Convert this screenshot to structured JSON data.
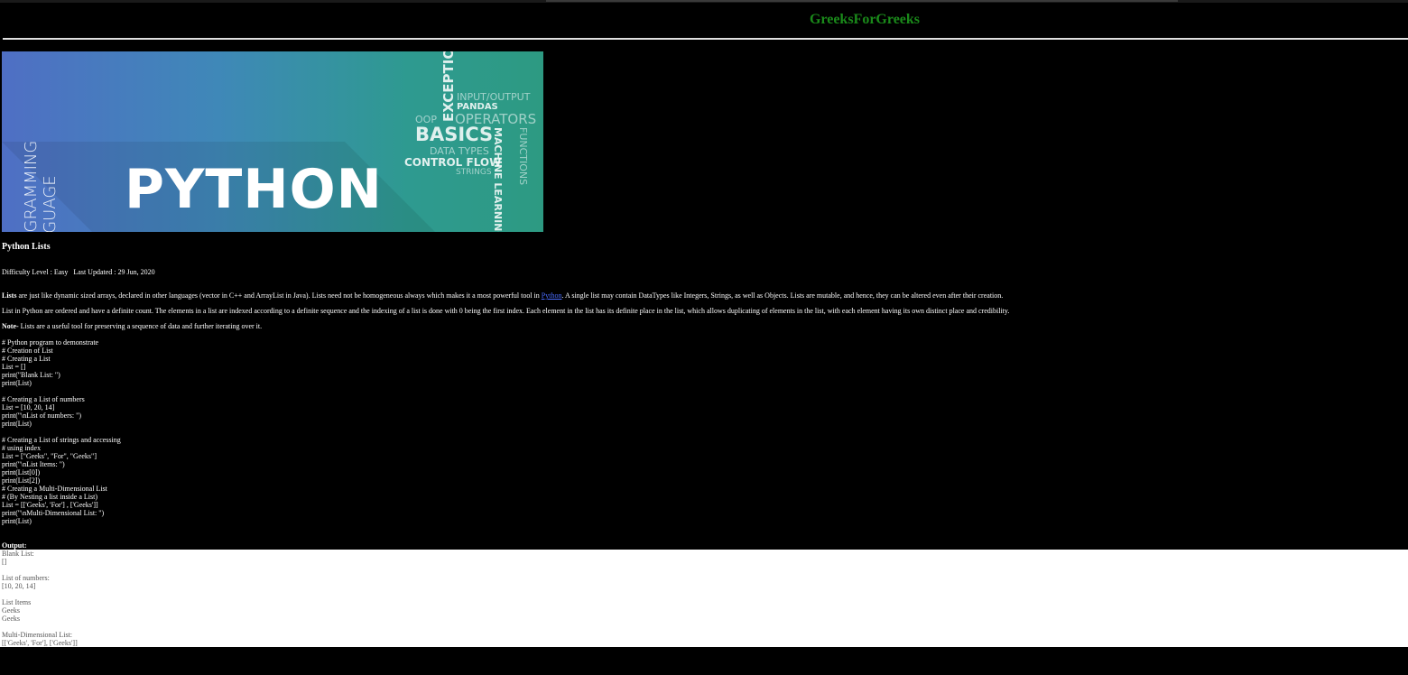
{
  "site": {
    "title": "GreeksForGreeks"
  },
  "banner": {
    "left_text_line1": "PROGRAMMING",
    "left_text_line2": "LANGUAGE",
    "main_text": "PYTHON",
    "tags": {
      "exception": "EXCEPTION",
      "input_output": "INPUT/OUTPUT",
      "pandas": "PANDAS",
      "oop": "OOP",
      "operators": "OPERATORS",
      "basics": "BASICS",
      "data_types": "DATA TYPES",
      "control_flow": "CONTROL FLOW",
      "strings": "STRINGS",
      "machine_learning": "MACHINE LEARNING",
      "functions": "FUNCTIONS"
    }
  },
  "article": {
    "title": "Python Lists",
    "difficulty": "Difficulty Level : Easy",
    "last_updated": "Last Updated : 29 Jun, 2020",
    "p1_bold": "Lists",
    "p1_text_a": " are just like dynamic sized arrays, declared in other languages (vector in C++ and ArrayList in Java). Lists need not be homogeneous always which makes it a most powerful tool in ",
    "p1_link": "Python",
    "p1_text_b": ". A single list may contain DataTypes like Integers, Strings, as well as Objects. Lists are mutable, and hence, they can be altered even after their creation.",
    "p2": "List in Python are ordered and have a definite count. The elements in a list are indexed according to a definite sequence and the indexing of a list is done with 0 being the first index. Each element in the list has its definite place in the list, which allows duplicating of elements in the list, with each element having its own distinct place and credibility.",
    "note_bold": "Note-",
    "note_text": " Lists are a useful tool for preserving a sequence of data and further iterating over it.",
    "code": "# Python program to demonstrate\n# Creation of List\n# Creating a List\nList = []\nprint(\"Blank List: \")\nprint(List)\n\n# Creating a List of numbers\nList = [10, 20, 14]\nprint(\"\\nList of numbers: \")\nprint(List)\n\n# Creating a List of strings and accessing\n# using index\nList = [\"Geeks\", \"For\", \"Geeks\"]\nprint(\"\\nList Items: \")\nprint(List[0])\nprint(List[2])\n# Creating a Multi-Dimensional List\n# (By Nesting a list inside a List)\nList = [['Geeks', 'For'] , ['Geeks']]\nprint(\"\\nMulti-Dimensional List: \")\nprint(List)",
    "output_label": "Output:",
    "output": "Blank List:\n[]\n\nList of numbers:\n[10, 20, 14]\n\nList Items\nGeeks\nGeeks\n\nMulti-Dimensional List:\n[['Geeks', 'For'], ['Geeks']]"
  }
}
